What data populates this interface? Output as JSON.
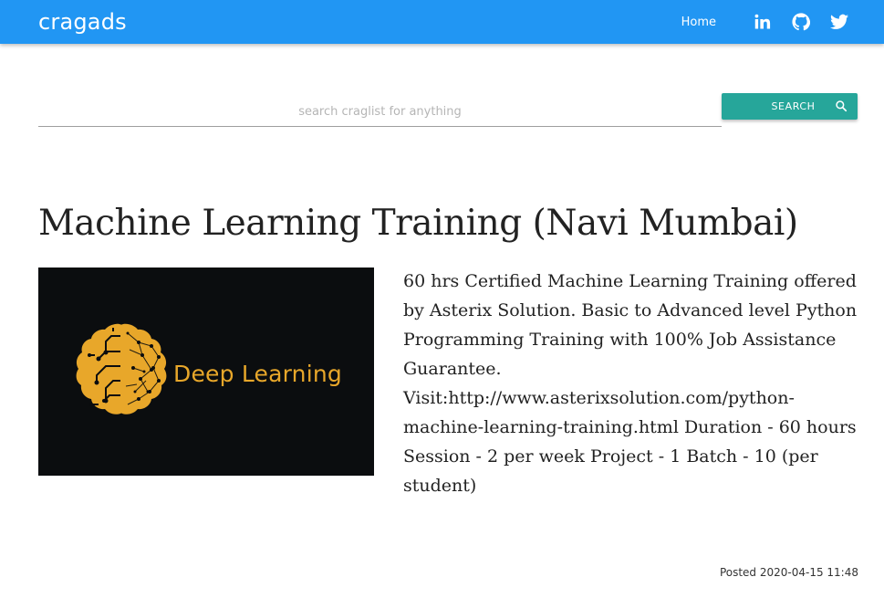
{
  "navbar": {
    "brand": "cragads",
    "home_label": "Home",
    "icons": [
      "linkedin-icon",
      "github-icon",
      "twitter-icon"
    ],
    "background_color": "#2196f3"
  },
  "search": {
    "value": "",
    "placeholder": "search craglist for anything",
    "button_label": "SEARCH",
    "button_color": "#26a69a"
  },
  "ad": {
    "title": "Machine Learning Training (Navi Mumbai)",
    "image_caption": "Deep Learning",
    "description": "60 hrs Certified Machine Learning Training offered by Asterix Solution. Basic to Advanced level Python Programming Training with 100% Job Assistance Guarantee. Visit:http://www.asterixsolution.com/python-machine-learning-training.html Duration - 60 hours Session - 2 per week Project - 1 Batch - 10 (per student)",
    "posted": "Posted 2020-04-15 11:48"
  }
}
